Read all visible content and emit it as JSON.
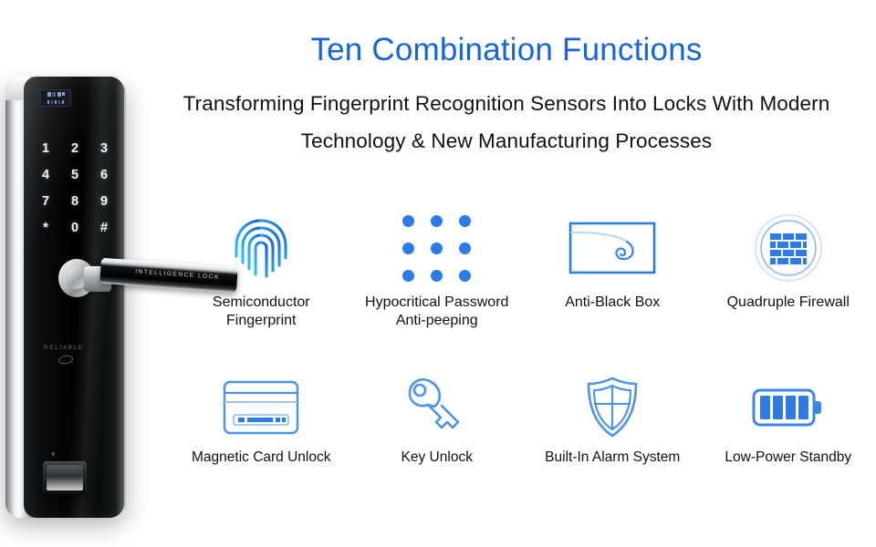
{
  "headline": {
    "title": "Ten Combination Functions",
    "subtitle": "Transforming Fingerprint Recognition Sensors Into Locks With Modern Technology & New Manufacturing Processes"
  },
  "colors": {
    "title_blue": "#1565e0",
    "icon_blue": "#2b7ce8",
    "icon_cyan": "#2bc4f0",
    "body_text": "#111111"
  },
  "device": {
    "name": "smart-door-lock",
    "handle_text": "INTELLIGENCE LOCK",
    "brand_text": "RELIABLE",
    "keypad": [
      [
        "1",
        "2",
        "3"
      ],
      [
        "4",
        "5",
        "6"
      ],
      [
        "7",
        "8",
        "9"
      ],
      [
        "*",
        "0",
        "#"
      ]
    ]
  },
  "features": {
    "row1": [
      {
        "label": "Semiconductor\nFingerprint",
        "icon": "fingerprint-icon"
      },
      {
        "label": "Hypocritical Password\nAnti-peeping",
        "icon": "dot-grid-icon"
      },
      {
        "label": "Anti-Black Box",
        "icon": "black-box-spiral-icon"
      },
      {
        "label": "Quadruple Firewall",
        "icon": "firewall-brick-icon"
      }
    ],
    "row2": [
      {
        "label": "Magnetic Card Unlock",
        "icon": "magnetic-card-icon"
      },
      {
        "label": "Key Unlock",
        "icon": "key-icon"
      },
      {
        "label": "Built-In Alarm System",
        "icon": "shield-icon"
      },
      {
        "label": "Low-Power Standby",
        "icon": "battery-icon"
      }
    ]
  }
}
